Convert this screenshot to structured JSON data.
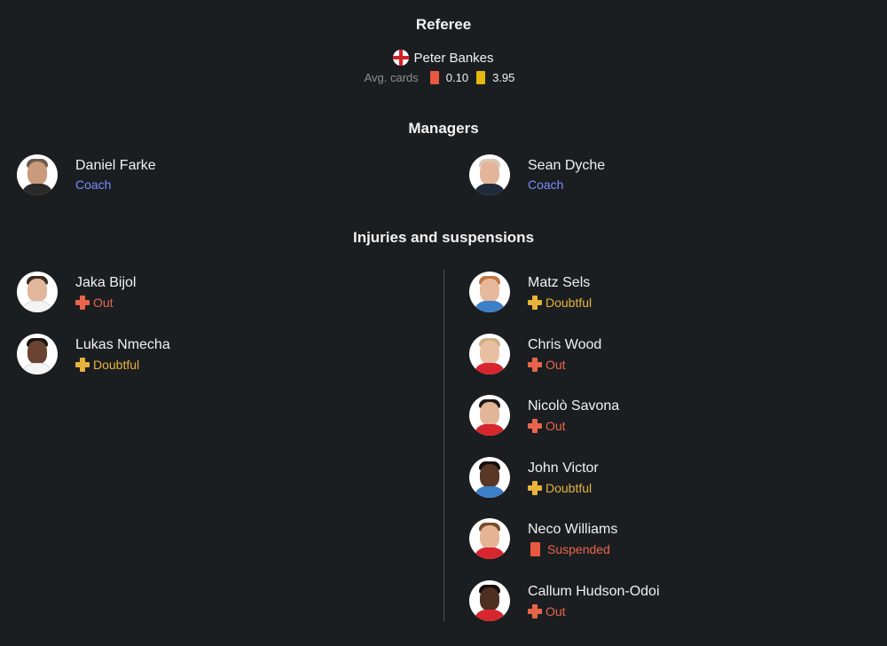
{
  "referee": {
    "title": "Referee",
    "name": "Peter Bankes",
    "flag": "england-flag-icon",
    "avg_cards_label": "Avg. cards",
    "red_avg": "0.10",
    "yellow_avg": "3.95"
  },
  "managers": {
    "title": "Managers",
    "home": {
      "name": "Daniel Farke",
      "role": "Coach"
    },
    "away": {
      "name": "Sean Dyche",
      "role": "Coach"
    }
  },
  "injuries": {
    "title": "Injuries and suspensions",
    "home": [
      {
        "name": "Jaka Bijol",
        "status": "Out",
        "type": "out"
      },
      {
        "name": "Lukas Nmecha",
        "status": "Doubtful",
        "type": "doubtful"
      }
    ],
    "away": [
      {
        "name": "Matz Sels",
        "status": "Doubtful",
        "type": "doubtful"
      },
      {
        "name": "Chris Wood",
        "status": "Out",
        "type": "out"
      },
      {
        "name": "Nicolò Savona",
        "status": "Out",
        "type": "out"
      },
      {
        "name": "John Victor",
        "status": "Doubtful",
        "type": "doubtful"
      },
      {
        "name": "Neco Williams",
        "status": "Suspended",
        "type": "suspended"
      },
      {
        "name": "Callum Hudson-Odoi",
        "status": "Out",
        "type": "out"
      }
    ]
  },
  "colors": {
    "background": "#1b1e21",
    "role_blue": "#7b8cff",
    "out_red": "#e8654c",
    "doubtful_yellow": "#e7b33a",
    "red_card": "#e8583f",
    "yellow_card": "#e3b80f"
  }
}
